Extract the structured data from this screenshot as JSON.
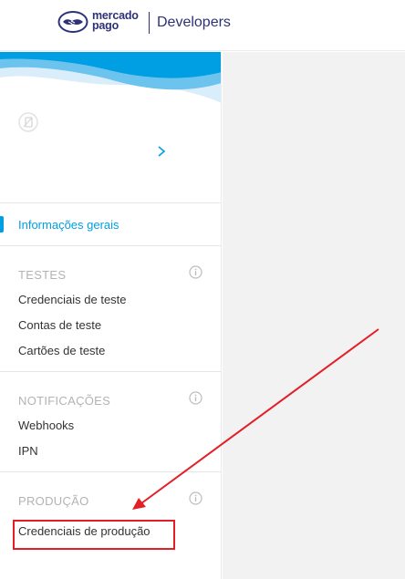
{
  "header": {
    "brand_line1": "mercado",
    "brand_line2": "pago",
    "product": "Developers",
    "logo_icon": "handshake-icon"
  },
  "colors": {
    "brand_navy": "#2d3277",
    "accent_blue": "#009ee3",
    "annotation_red": "#e41e26",
    "main_bg": "#f2f2f2"
  },
  "sidebar": {
    "app_icon": "app-placeholder-icon",
    "chevron_icon": "chevron-right-icon",
    "general": {
      "label": "Informações gerais"
    },
    "sections": [
      {
        "title": "TESTES",
        "items": [
          "Credenciais de teste",
          "Contas de teste",
          "Cartões de teste"
        ]
      },
      {
        "title": "NOTIFICAÇÕES",
        "items": [
          "Webhooks",
          "IPN"
        ]
      },
      {
        "title": "PRODUÇÃO",
        "items": [
          "Credenciais de produção"
        ]
      }
    ]
  }
}
